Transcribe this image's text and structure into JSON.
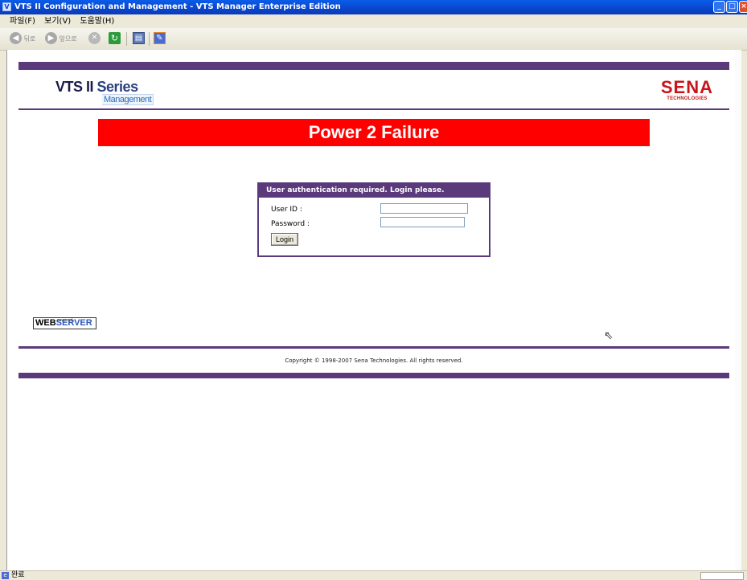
{
  "window": {
    "title": "VTS II Configuration and Management - VTS Manager Enterprise Edition",
    "app_icon": "V",
    "controls": [
      "_",
      "□",
      "×"
    ]
  },
  "menubar": {
    "items": [
      "파일(F)",
      "보기(V)",
      "도움말(H)"
    ]
  },
  "toolbar": {
    "back_label": "뒤로",
    "forward_label": "앞으로",
    "icons": [
      "back-icon",
      "forward-icon",
      "stop-icon",
      "refresh-icon",
      "print-icon",
      "edit-icon"
    ]
  },
  "header": {
    "logo_main": "VTS II",
    "logo_series": "Series",
    "logo_sub": "Management",
    "brand": "SENA",
    "brand_sub": "TECHNOLOGIES"
  },
  "alert": {
    "text": "Power 2 Failure",
    "color": "#fe0000"
  },
  "login": {
    "heading": "User authentication required. Login please.",
    "userid_label": "User ID :",
    "userid_value": "",
    "password_label": "Password :",
    "password_value": "",
    "button": "Login"
  },
  "badge": {
    "web": "WEB",
    "server": "SERVER",
    "tiny": "powered"
  },
  "footer": {
    "copyright": "Copyright © 1998-2007 Sena Technologies. All rights reserved."
  },
  "statusbar": {
    "text": "완료"
  },
  "colors": {
    "accent": "#5b3a7c",
    "titlebar": "#0a46cc"
  }
}
